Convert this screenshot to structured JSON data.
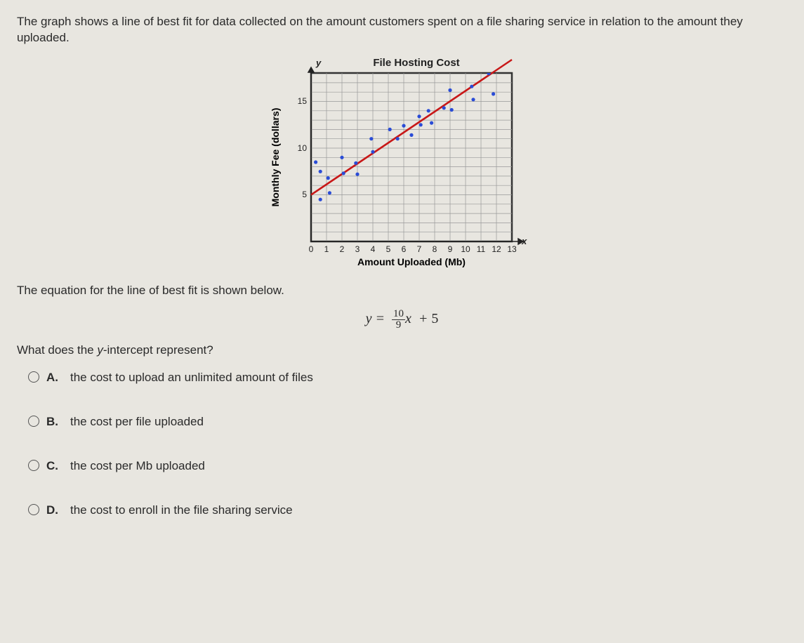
{
  "intro": "The graph shows a line of best fit for data collected on the amount customers spent on a file sharing service in relation to the amount they uploaded.",
  "chart_data": {
    "type": "scatter",
    "title": "File Hosting Cost",
    "xlabel": "Amount Uploaded (Mb)",
    "ylabel": "Monthly Fee (dollars)",
    "x_var": "x",
    "y_var": "y",
    "xlim": [
      0,
      13
    ],
    "ylim": [
      0,
      18
    ],
    "xticks": [
      0,
      1,
      2,
      3,
      4,
      5,
      6,
      7,
      8,
      9,
      10,
      11,
      12,
      13
    ],
    "yticks": [
      5,
      10,
      15
    ],
    "grid": true,
    "points": [
      {
        "x": 0.3,
        "y": 8.5
      },
      {
        "x": 0.6,
        "y": 7.5
      },
      {
        "x": 0.6,
        "y": 4.5
      },
      {
        "x": 1.1,
        "y": 6.8
      },
      {
        "x": 1.2,
        "y": 5.2
      },
      {
        "x": 2.0,
        "y": 9.0
      },
      {
        "x": 2.1,
        "y": 7.3
      },
      {
        "x": 2.9,
        "y": 8.4
      },
      {
        "x": 3.0,
        "y": 7.2
      },
      {
        "x": 3.9,
        "y": 11.0
      },
      {
        "x": 4.0,
        "y": 9.6
      },
      {
        "x": 5.1,
        "y": 12.0
      },
      {
        "x": 5.6,
        "y": 11.0
      },
      {
        "x": 6.0,
        "y": 12.4
      },
      {
        "x": 6.5,
        "y": 11.4
      },
      {
        "x": 7.0,
        "y": 13.4
      },
      {
        "x": 7.1,
        "y": 12.5
      },
      {
        "x": 7.6,
        "y": 14.0
      },
      {
        "x": 7.8,
        "y": 12.7
      },
      {
        "x": 8.6,
        "y": 14.3
      },
      {
        "x": 9.0,
        "y": 16.2
      },
      {
        "x": 9.1,
        "y": 14.1
      },
      {
        "x": 10.4,
        "y": 16.6
      },
      {
        "x": 10.5,
        "y": 15.2
      },
      {
        "x": 11.5,
        "y": 18.0
      },
      {
        "x": 11.8,
        "y": 15.8
      }
    ],
    "best_fit": {
      "slope_num": 10,
      "slope_den": 9,
      "intercept": 5,
      "x0": 0,
      "y0": 5,
      "x1": 12.5,
      "y1": 18.9
    }
  },
  "eq_intro": "The equation for the line of best fit is shown below.",
  "equation": {
    "lhs": "y",
    "num": "10",
    "den": "9",
    "var": "x",
    "intercept": "5"
  },
  "question_prefix": "What does the ",
  "question_var": "y",
  "question_suffix": "-intercept represent?",
  "options": {
    "A": "the cost to upload an unlimited amount of files",
    "B": "the cost per file uploaded",
    "C": "the cost per Mb uploaded",
    "D": "the cost to enroll in the file sharing service"
  },
  "labels": {
    "A": "A.",
    "B": "B.",
    "C": "C.",
    "D": "D."
  }
}
